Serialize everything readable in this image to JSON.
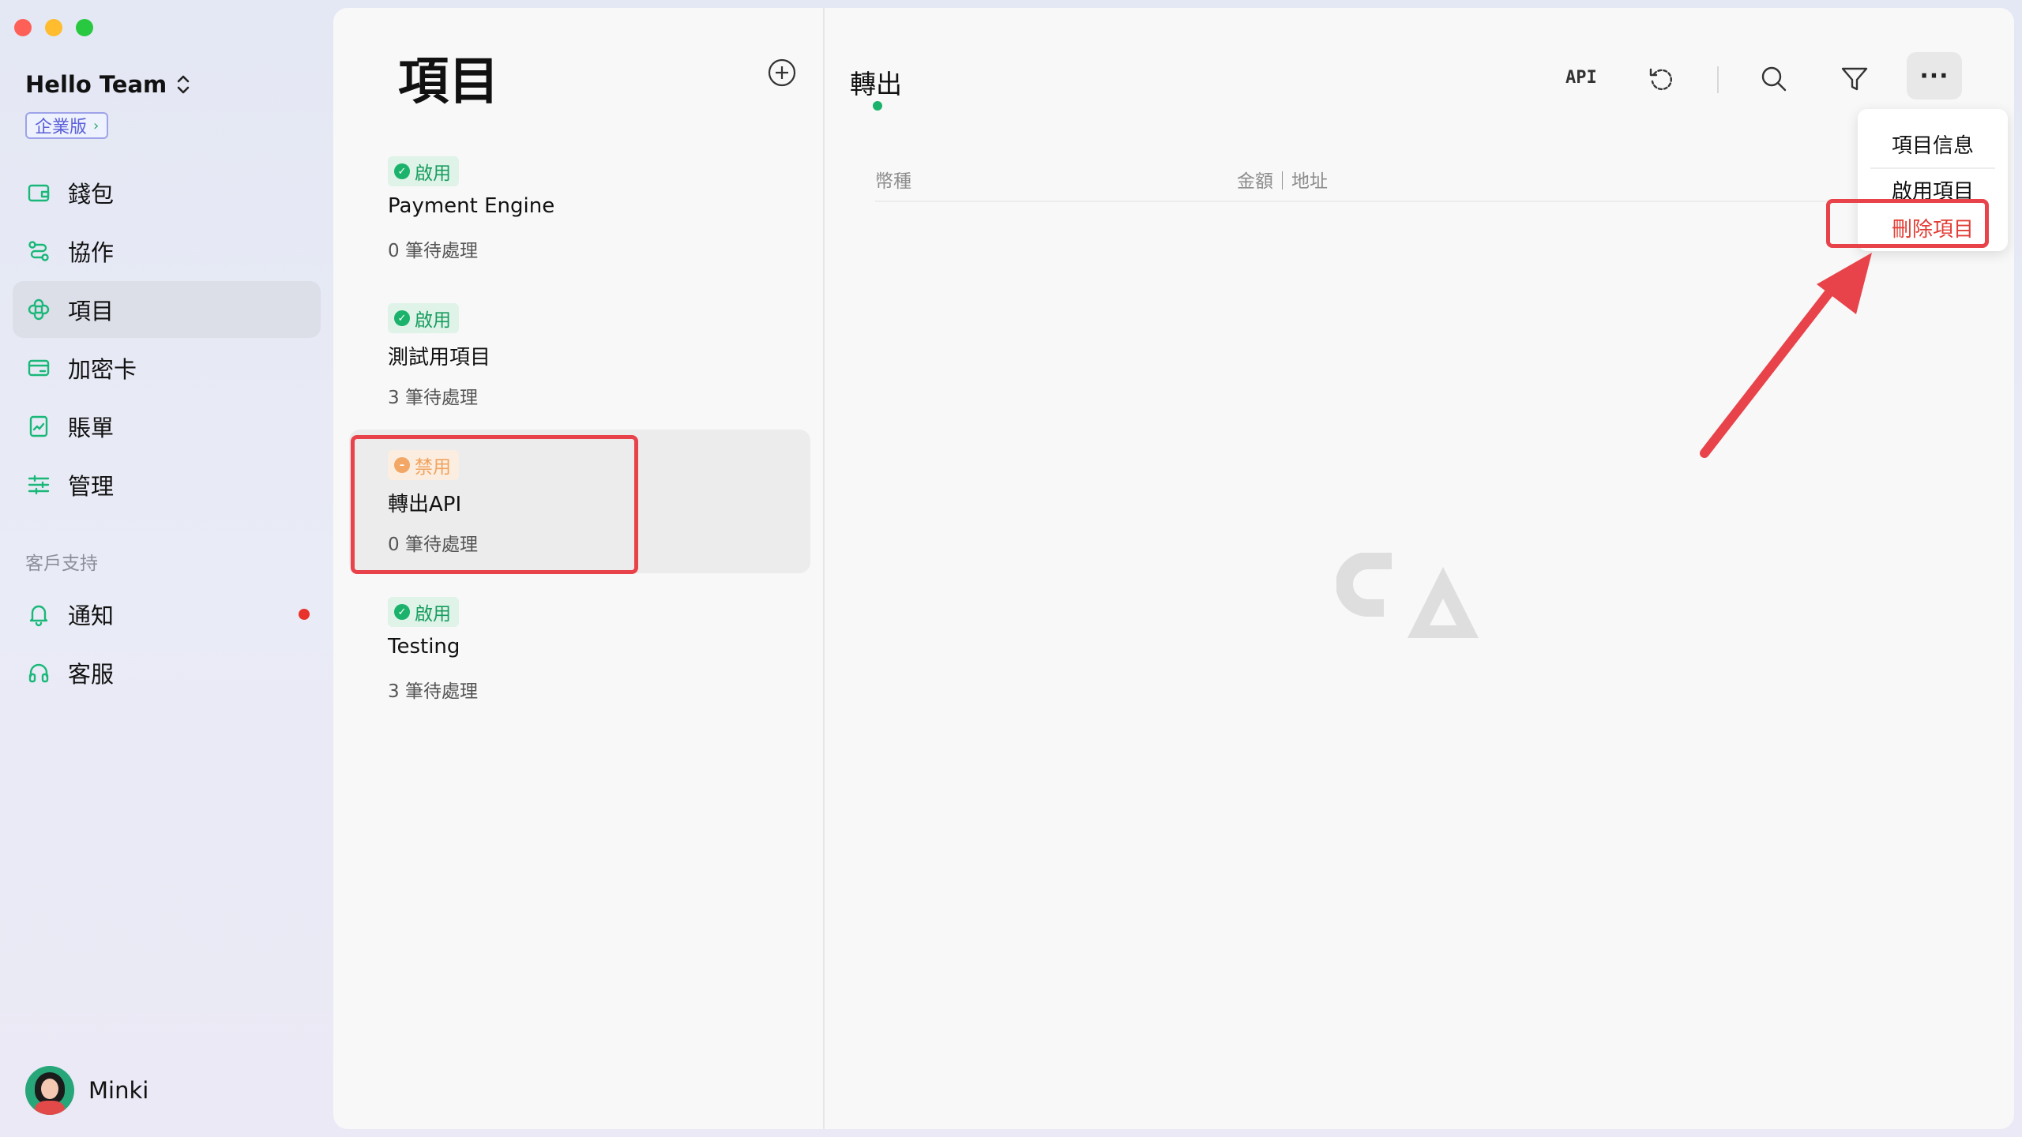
{
  "sidebar": {
    "team_name": "Hello Team",
    "plan_badge": "企業版",
    "nav": [
      {
        "label": "錢包",
        "icon": "wallet-icon"
      },
      {
        "label": "協作",
        "icon": "collaboration-icon"
      },
      {
        "label": "項目",
        "icon": "project-icon",
        "active": true
      },
      {
        "label": "加密卡",
        "icon": "card-icon"
      },
      {
        "label": "賬單",
        "icon": "bill-icon"
      },
      {
        "label": "管理",
        "icon": "settings-sliders-icon"
      }
    ],
    "support_section": "客戶支持",
    "support": [
      {
        "label": "通知",
        "icon": "bell-icon",
        "has_dot": true
      },
      {
        "label": "客服",
        "icon": "headset-icon"
      }
    ],
    "user_name": "Minki"
  },
  "projects": {
    "title": "項目",
    "items": [
      {
        "status": "啟用",
        "status_type": "enabled",
        "name": "Payment Engine",
        "pending": "0 筆待處理"
      },
      {
        "status": "啟用",
        "status_type": "enabled",
        "name": "測試用項目",
        "pending": "3 筆待處理"
      },
      {
        "status": "禁用",
        "status_type": "disabled",
        "name": "轉出API",
        "pending": "0 筆待處理",
        "selected": true
      },
      {
        "status": "啟用",
        "status_type": "enabled",
        "name": "Testing",
        "pending": "3 筆待處理"
      }
    ]
  },
  "detail": {
    "title": "轉出",
    "toolbar": {
      "api": "API",
      "more": "···"
    },
    "columns": [
      "幣種",
      "金額｜地址"
    ]
  },
  "menu": {
    "items": [
      "項目信息",
      "啟用項目",
      "刪除項目"
    ]
  },
  "colors": {
    "accent_green": "#19b879",
    "danger_red": "#e23d35",
    "annotation_red": "#e8434a",
    "disabled_orange": "#f0a35e"
  }
}
